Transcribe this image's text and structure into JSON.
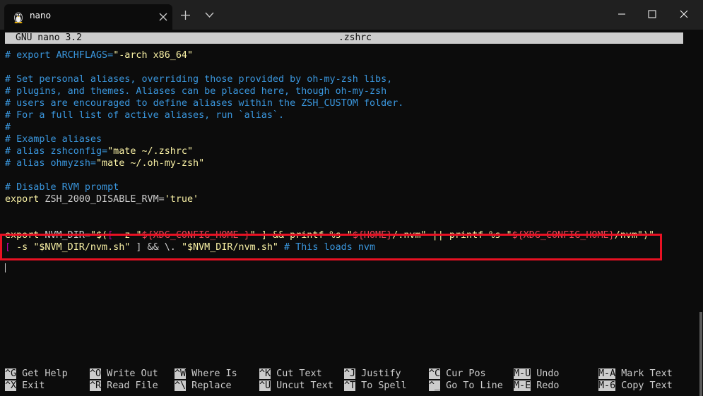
{
  "window": {
    "tab_title": "nano",
    "new_tab_icon": "plus-icon",
    "dropdown_icon": "chevron-down-icon"
  },
  "nano": {
    "version": "GNU nano 3.2",
    "filename": ".zshrc"
  },
  "lines": [
    {
      "row": 1,
      "segments": [
        {
          "text": "# export ARCHFLAGS=",
          "cls": "cm"
        },
        {
          "text": "\"-arch x86_64\"",
          "cls": "st"
        }
      ]
    },
    {
      "row": 3,
      "segments": [
        {
          "text": "# Set personal aliases, overriding those provided by oh-my-zsh libs,",
          "cls": "cm"
        }
      ]
    },
    {
      "row": 4,
      "segments": [
        {
          "text": "# plugins, and themes. Aliases can be placed here, though oh-my-zsh",
          "cls": "cm"
        }
      ]
    },
    {
      "row": 5,
      "segments": [
        {
          "text": "# users are encouraged to define aliases within the ZSH_CUSTOM folder.",
          "cls": "cm"
        }
      ]
    },
    {
      "row": 6,
      "segments": [
        {
          "text": "# For a full list of active aliases, run `alias`.",
          "cls": "cm"
        }
      ]
    },
    {
      "row": 7,
      "segments": [
        {
          "text": "#",
          "cls": "cm"
        }
      ]
    },
    {
      "row": 8,
      "segments": [
        {
          "text": "# Example aliases",
          "cls": "cm"
        }
      ]
    },
    {
      "row": 9,
      "segments": [
        {
          "text": "# alias zshconfig=",
          "cls": "cm"
        },
        {
          "text": "\"mate ~/.zshrc\"",
          "cls": "st"
        }
      ]
    },
    {
      "row": 10,
      "segments": [
        {
          "text": "# alias ohmyzsh=",
          "cls": "cm"
        },
        {
          "text": "\"mate ~/.oh-my-zsh\"",
          "cls": "st"
        }
      ]
    },
    {
      "row": 12,
      "segments": [
        {
          "text": "# Disable RVM prompt",
          "cls": "cm"
        }
      ]
    },
    {
      "row": 13,
      "segments": [
        {
          "text": "export",
          "cls": "st"
        },
        {
          "text": " ZSH_2000_DISABLE_RVM=",
          "cls": "df"
        },
        {
          "text": "'true'",
          "cls": "st"
        }
      ]
    },
    {
      "row": 16,
      "segments": [
        {
          "text": "export",
          "cls": "st"
        },
        {
          "text": " NVM_DIR=",
          "cls": "df"
        },
        {
          "text": "\"$(",
          "cls": "st"
        },
        {
          "text": "[",
          "cls": "pk"
        },
        {
          "text": " -z ",
          "cls": "st"
        },
        {
          "text": "\"",
          "cls": "st"
        },
        {
          "text": "${XDG_CONFIG_HOME-}",
          "cls": "rd"
        },
        {
          "text": "\"",
          "cls": "st"
        },
        {
          "text": " ] && printf %s ",
          "cls": "st"
        },
        {
          "text": "\"",
          "cls": "st"
        },
        {
          "text": "${HOME}",
          "cls": "rd"
        },
        {
          "text": "/.nvm\"",
          "cls": "st"
        },
        {
          "text": " || printf %s ",
          "cls": "st"
        },
        {
          "text": "\"",
          "cls": "st"
        },
        {
          "text": "${XDG_CONFIG_HOME}",
          "cls": "rd"
        },
        {
          "text": "/nvm\")\"",
          "cls": "st"
        }
      ]
    },
    {
      "row": 17,
      "segments": [
        {
          "text": "[",
          "cls": "pk"
        },
        {
          "text": " -s ",
          "cls": "st"
        },
        {
          "text": "\"$NVM_DIR/nvm.sh\"",
          "cls": "st"
        },
        {
          "text": " ] && \\. ",
          "cls": "df"
        },
        {
          "text": "\"$NVM_DIR/nvm.sh\"",
          "cls": "st"
        },
        {
          "text": " # This loads nvm",
          "cls": "cm"
        }
      ]
    }
  ],
  "shortcuts": [
    {
      "key": "^G",
      "label": "Get Help",
      "col": 0,
      "row": 0
    },
    {
      "key": "^X",
      "label": "Exit",
      "col": 0,
      "row": 1
    },
    {
      "key": "^O",
      "label": "Write Out",
      "col": 1,
      "row": 0
    },
    {
      "key": "^R",
      "label": "Read File",
      "col": 1,
      "row": 1
    },
    {
      "key": "^W",
      "label": "Where Is",
      "col": 2,
      "row": 0
    },
    {
      "key": "^\\",
      "label": "Replace",
      "col": 2,
      "row": 1
    },
    {
      "key": "^K",
      "label": "Cut Text",
      "col": 3,
      "row": 0
    },
    {
      "key": "^U",
      "label": "Uncut Text",
      "col": 3,
      "row": 1
    },
    {
      "key": "^J",
      "label": "Justify",
      "col": 4,
      "row": 0
    },
    {
      "key": "^T",
      "label": "To Spell",
      "col": 4,
      "row": 1
    },
    {
      "key": "^C",
      "label": "Cur Pos",
      "col": 5,
      "row": 0
    },
    {
      "key": "^_",
      "label": "Go To Line",
      "col": 5,
      "row": 1
    },
    {
      "key": "M-U",
      "label": "Undo",
      "col": 6,
      "row": 0
    },
    {
      "key": "M-E",
      "label": "Redo",
      "col": 6,
      "row": 1
    },
    {
      "key": "M-A",
      "label": "Mark Text",
      "col": 7,
      "row": 0
    },
    {
      "key": "M-6",
      "label": "Copy Text",
      "col": 7,
      "row": 1
    }
  ],
  "colors": {
    "comment": "#3a96dd",
    "string": "#f9f1a5",
    "highlight_border": "#e81123"
  }
}
